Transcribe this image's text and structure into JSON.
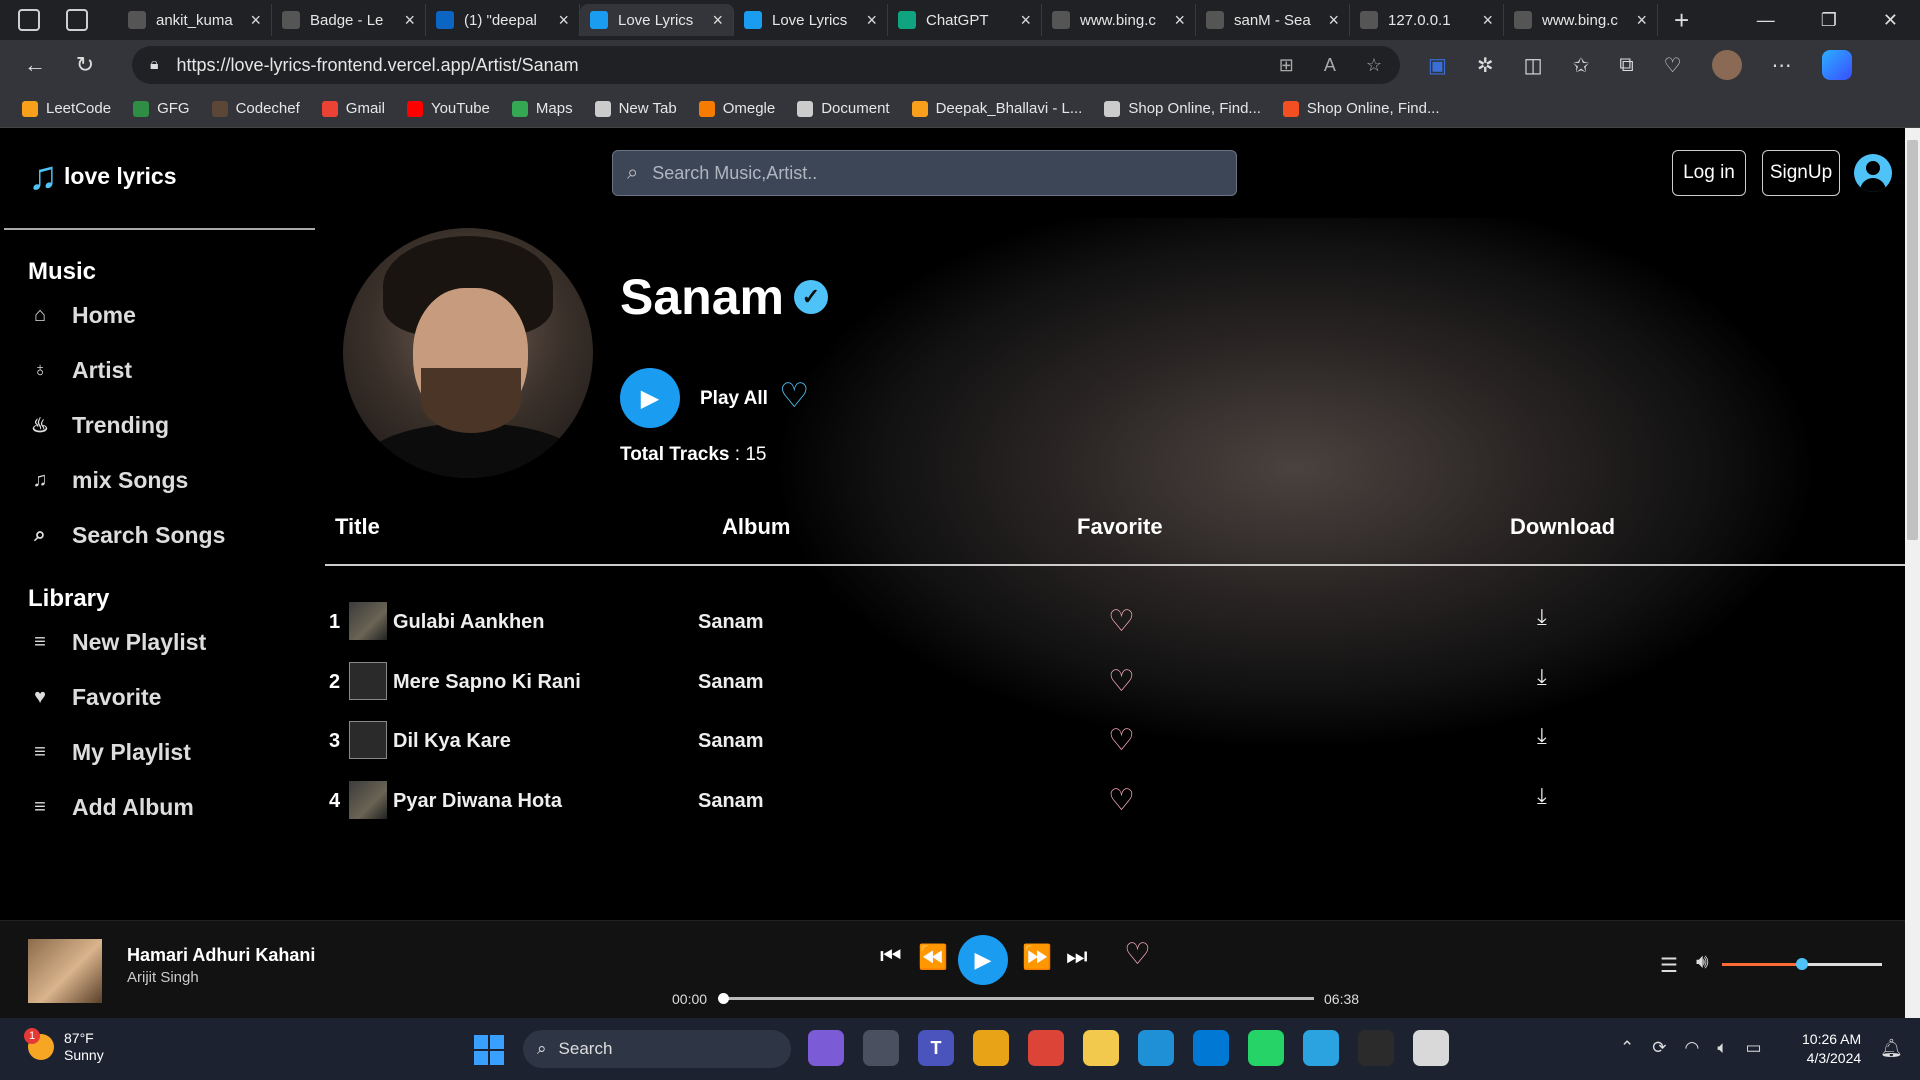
{
  "browser": {
    "tabs": [
      {
        "label": "ankit_kuma",
        "color": "#555"
      },
      {
        "label": "Badge - Le",
        "color": "#555"
      },
      {
        "label": "(1) \"deepal",
        "color": "#0a66c2"
      },
      {
        "label": "Love Lyrics",
        "color": "#1a9cf0",
        "active": true
      },
      {
        "label": "Love Lyrics",
        "color": "#1a9cf0"
      },
      {
        "label": "ChatGPT",
        "color": "#10a37f"
      },
      {
        "label": "www.bing.c",
        "color": "#555"
      },
      {
        "label": "sanM - Sea",
        "color": "#555"
      },
      {
        "label": "127.0.0.1",
        "color": "#555"
      },
      {
        "label": "www.bing.c",
        "color": "#555"
      }
    ],
    "url": "https://love-lyrics-frontend.vercel.app/Artist/Sanam",
    "bookmarks": [
      {
        "label": "LeetCode",
        "color": "#f89f1b"
      },
      {
        "label": "GFG",
        "color": "#2f8d46"
      },
      {
        "label": "Codechef",
        "color": "#5b4638"
      },
      {
        "label": "Gmail",
        "color": "#ea4335"
      },
      {
        "label": "YouTube",
        "color": "#ff0000"
      },
      {
        "label": "Maps",
        "color": "#34a853"
      },
      {
        "label": "New Tab",
        "color": "#cccccc"
      },
      {
        "label": "Omegle",
        "color": "#f57c00"
      },
      {
        "label": "Document",
        "color": "#cccccc"
      },
      {
        "label": "Deepak_Bhallavi - L...",
        "color": "#f89f1b"
      },
      {
        "label": "Shop Online, Find...",
        "color": "#cccccc"
      },
      {
        "label": "Shop Online, Find...",
        "color": "#f25022"
      }
    ]
  },
  "app": {
    "logo_text": "love lyrics",
    "search_placeholder": "Search Music,Artist..",
    "login_label": "Log in",
    "signup_label": "SignUp",
    "sidebar": {
      "music_heading": "Music",
      "music_items": [
        {
          "label": "Home",
          "icon": "home-icon",
          "glyph": "⌂"
        },
        {
          "label": "Artist",
          "icon": "artist-icon",
          "glyph": "♁"
        },
        {
          "label": "Trending",
          "icon": "trending-icon",
          "glyph": "♨"
        },
        {
          "label": "mix Songs",
          "icon": "music-note-icon",
          "glyph": "♫"
        },
        {
          "label": "Search Songs",
          "icon": "search-songs-icon",
          "glyph": "⌕"
        }
      ],
      "library_heading": "Library",
      "library_items": [
        {
          "label": "New Playlist",
          "icon": "new-playlist-icon",
          "glyph": "≡"
        },
        {
          "label": "Favorite",
          "icon": "favorite-heart-icon",
          "glyph": "♥"
        },
        {
          "label": "My Playlist",
          "icon": "my-playlist-icon",
          "glyph": "≡"
        },
        {
          "label": "Add Album",
          "icon": "add-album-icon",
          "glyph": "≡"
        }
      ]
    },
    "artist": {
      "name": "Sanam",
      "verified": true,
      "play_all_label": "Play All",
      "total_tracks_label": "Total Tracks",
      "total_tracks_value": ": 15"
    },
    "table": {
      "headers": [
        "Title",
        "Album",
        "Favorite",
        "Download"
      ],
      "rows": [
        {
          "num": "1",
          "title": "Gulabi Aankhen",
          "album": "Sanam"
        },
        {
          "num": "2",
          "title": "Mere Sapno Ki Rani",
          "album": "Sanam"
        },
        {
          "num": "3",
          "title": "Dil Kya Kare",
          "album": "Sanam"
        },
        {
          "num": "4",
          "title": "Pyar Diwana Hota",
          "album": "Sanam"
        }
      ]
    },
    "player": {
      "title": "Hamari Adhuri Kahani",
      "artist": "Arijit Singh",
      "current_time": "00:00",
      "total_time": "06:38",
      "progress": 0,
      "volume": 0.5
    }
  },
  "taskbar": {
    "temperature": "87°F",
    "condition": "Sunny",
    "weather_badge": "1",
    "search_label": "Search",
    "time": "10:26 AM",
    "date": "4/3/2024"
  }
}
